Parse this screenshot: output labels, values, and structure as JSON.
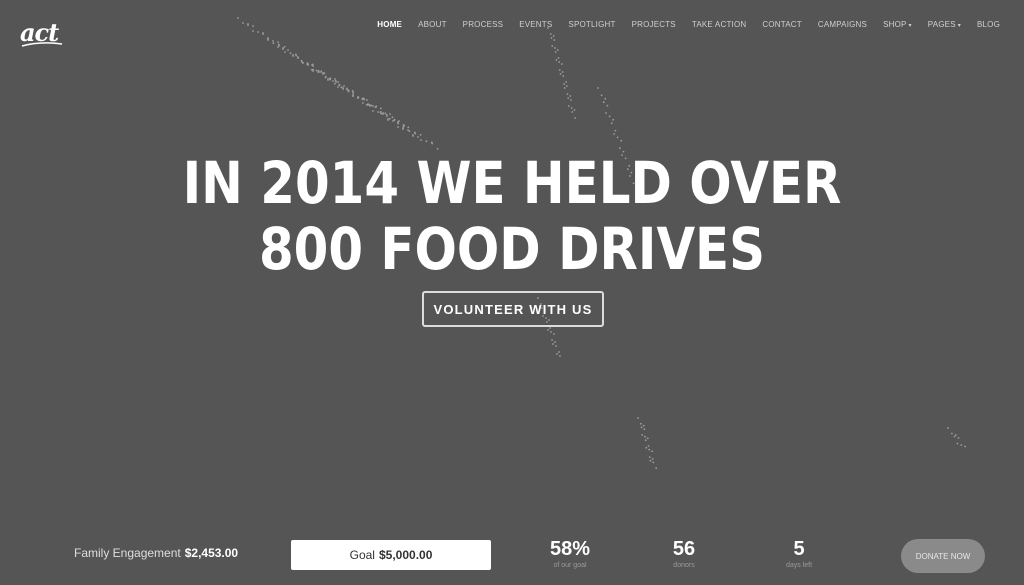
{
  "logo": {
    "text": "act"
  },
  "nav": {
    "items": [
      {
        "label": "HOME",
        "active": true,
        "dropdown": false
      },
      {
        "label": "ABOUT",
        "active": false,
        "dropdown": false
      },
      {
        "label": "PROCESS",
        "active": false,
        "dropdown": false
      },
      {
        "label": "EVENTS",
        "active": false,
        "dropdown": false
      },
      {
        "label": "SPOTLIGHT",
        "active": false,
        "dropdown": false
      },
      {
        "label": "PROJECTS",
        "active": false,
        "dropdown": false
      },
      {
        "label": "TAKE ACTION",
        "active": false,
        "dropdown": false
      },
      {
        "label": "CONTACT",
        "active": false,
        "dropdown": false
      },
      {
        "label": "CAMPAIGNS",
        "active": false,
        "dropdown": false
      },
      {
        "label": "SHOP",
        "active": false,
        "dropdown": true
      },
      {
        "label": "PAGES",
        "active": false,
        "dropdown": true
      },
      {
        "label": "BLOG",
        "active": false,
        "dropdown": false
      }
    ],
    "caret": "▾"
  },
  "hero": {
    "line1": "IN 2014 WE HELD OVER",
    "line2": "800 FOOD DRIVES",
    "button_label": "VOLUNTEER WITH US"
  },
  "campaign": {
    "label": "Family Engagement",
    "raised": "$2,453.00",
    "goal_label": "Goal",
    "goal_amount": "$5,000.00",
    "percent": {
      "value": "58%",
      "label": "of our goal"
    },
    "donors": {
      "value": "56",
      "label": "donors"
    },
    "days": {
      "value": "5",
      "label": "days left"
    },
    "donate_label": "DONATE NOW"
  },
  "colors": {
    "background": "#555555",
    "text": "#ffffff",
    "donate_button": "#8a8a8a"
  }
}
